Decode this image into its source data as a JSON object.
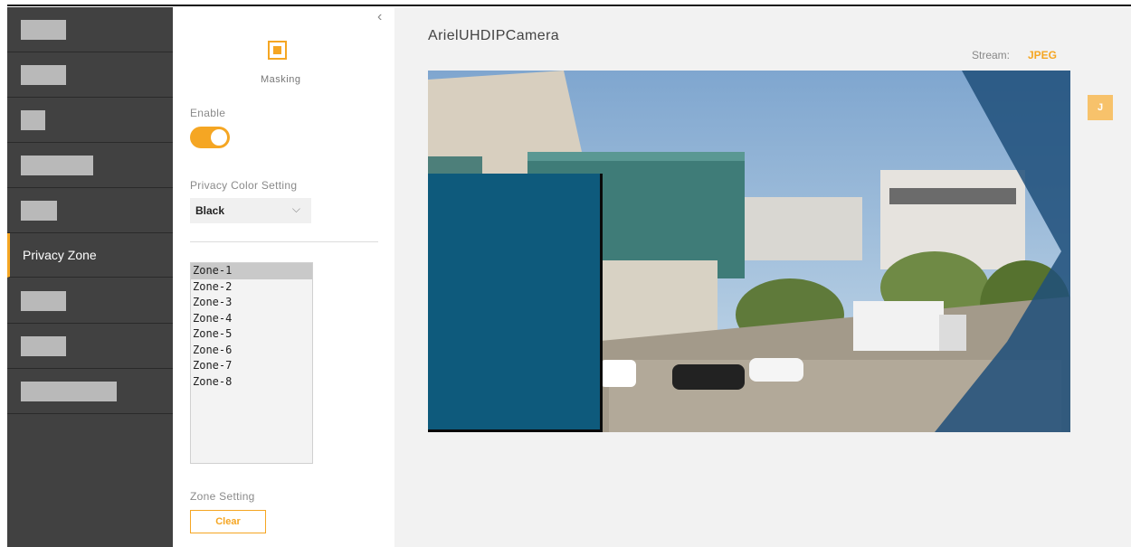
{
  "sidebar": {
    "active_item": "Privacy Zone"
  },
  "panel": {
    "masking_label": "Masking",
    "enable_label": "Enable",
    "enable_on": true,
    "privacy_color_label": "Privacy Color Setting",
    "privacy_color_value": "Black",
    "zones": [
      "Zone-1",
      "Zone-2",
      "Zone-3",
      "Zone-4",
      "Zone-5",
      "Zone-6",
      "Zone-7",
      "Zone-8"
    ],
    "selected_zone": "Zone-1",
    "zone_setting_label": "Zone Setting",
    "clear_label": "Clear"
  },
  "main": {
    "camera_title": "ArielUHDIPCamera",
    "stream_label": "Stream:",
    "stream_value": "JPEG",
    "side_button": "J",
    "mask_color": "#0e5a7c"
  },
  "colors": {
    "accent": "#f5a623",
    "sidebar_bg": "#414141"
  },
  "icons": {
    "collapse": "chevron-left-icon",
    "masking": "masking-icon",
    "dropdown": "chevron-down-icon"
  }
}
